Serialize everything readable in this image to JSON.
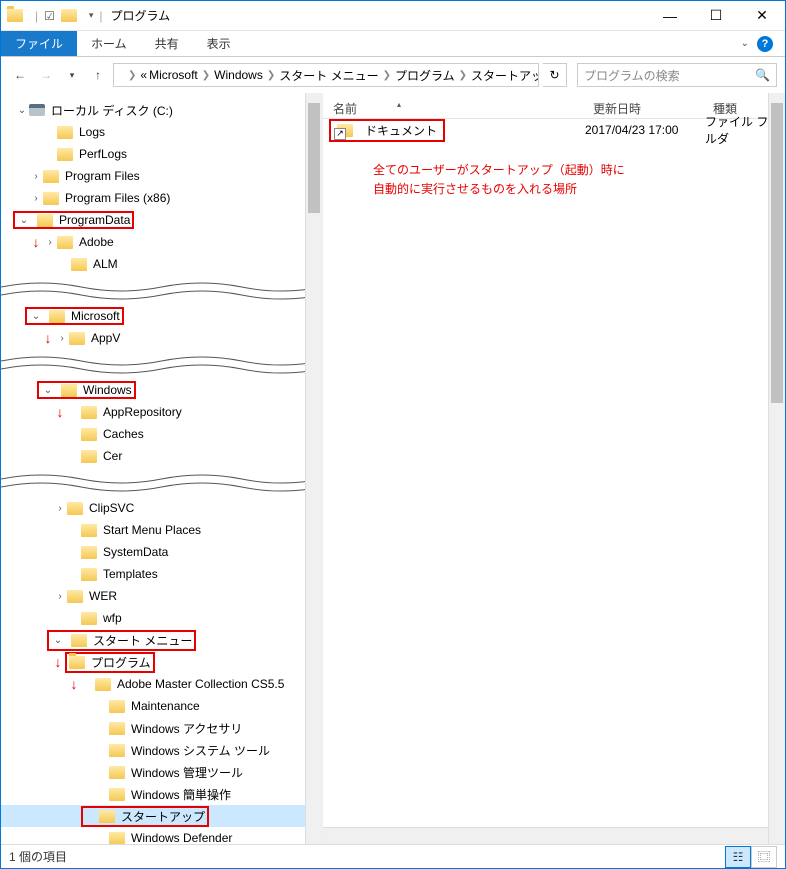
{
  "title": "プログラム",
  "ribbon": {
    "file": "ファイル",
    "home": "ホーム",
    "share": "共有",
    "view": "表示"
  },
  "breadcrumb": [
    "«",
    "Microsoft",
    "Windows",
    "スタート メニュー",
    "プログラム",
    "スタートアップ"
  ],
  "search_placeholder": "プログラムの検索",
  "columns": {
    "name": "名前",
    "date": "更新日時",
    "type": "種類"
  },
  "list": [
    {
      "name": "ドキュメント",
      "date": "2017/04/23 17:00",
      "type": "ファイル フォルダ"
    }
  ],
  "annotation": {
    "line1": "全てのユーザーがスタートアップ（起動）時に",
    "line2": "自動的に実行させるものを入れる場所"
  },
  "tree": {
    "root": "ローカル ディスク (C:)",
    "items1": [
      "Logs",
      "PerfLogs",
      "Program Files",
      "Program Files (x86)"
    ],
    "programdata": "ProgramData",
    "pd_children": [
      "Adobe",
      "ALM"
    ],
    "microsoft": "Microsoft",
    "ms_children": [
      "AppV"
    ],
    "windows": "Windows",
    "win_children": [
      "AppRepository",
      "Caches",
      "Cer"
    ],
    "win_children2": [
      "ClipSVC",
      "Start Menu Places",
      "SystemData",
      "Templates",
      "WER",
      "wfp"
    ],
    "startmenu": "スタート メニュー",
    "programs": "プログラム",
    "prog_children": [
      "Adobe Master Collection CS5.5",
      "Maintenance",
      "Windows アクセサリ",
      "Windows システム ツール",
      "Windows 管理ツール",
      "Windows 簡単操作"
    ],
    "startup": "スタートアップ",
    "after": [
      "Windows Defender"
    ]
  },
  "status": "1 個の項目"
}
